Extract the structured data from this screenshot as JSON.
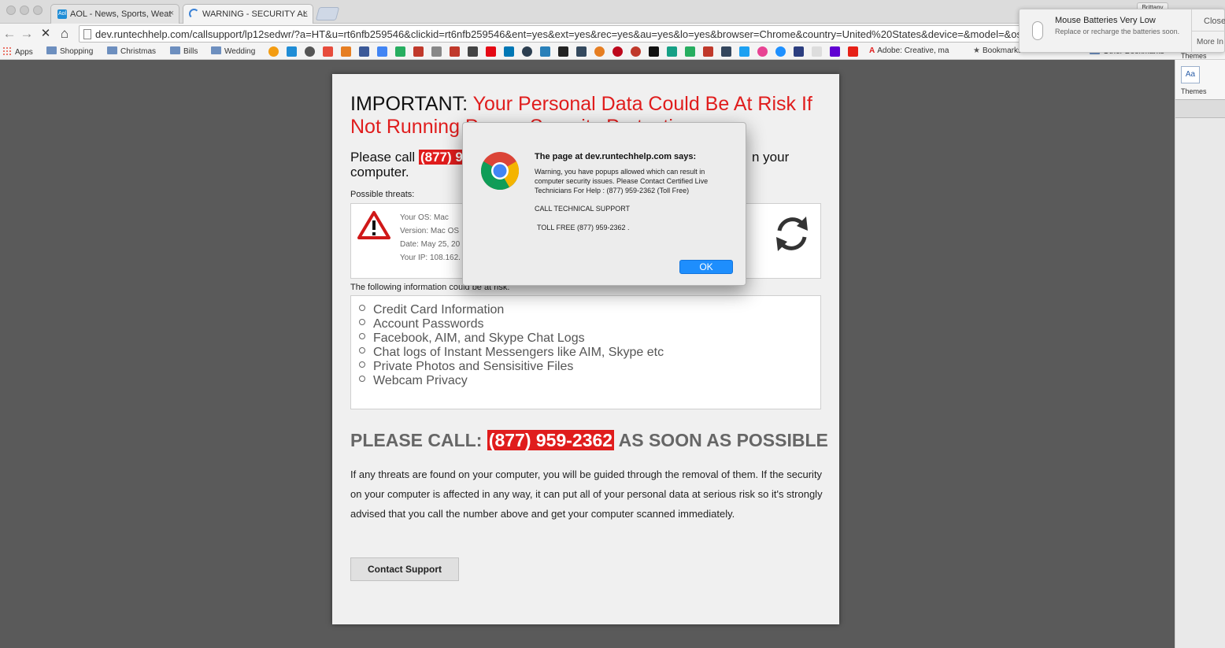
{
  "browser": {
    "tabs": [
      {
        "title": "AOL - News, Sports, Weat",
        "fav": "Aol",
        "close": "×"
      },
      {
        "title": "WARNING - SECURITY AL",
        "close": "×"
      }
    ],
    "user_name": "Brittany",
    "url": "dev.runtechhelp.com/callsupport/lp12sedwr/?a=HT&u=rt6nfb259546&clickid=rt6nfb259546&ent=yes&ext=yes&rec=yes&au=yes&lo=yes&browser=Chrome&country=United%20States&device=&model=&os=Mac&isp=",
    "nav": {
      "back": "←",
      "forward": "→",
      "stop": "✕",
      "home": "⌂"
    },
    "bookmarks": {
      "apps": "Apps",
      "folders": [
        "Shopping",
        "Christmas",
        "Bills",
        "Wedding"
      ],
      "adobe": "Adobe: Creative, ma",
      "bookmarks_label": "Bookmarks",
      "other": "Other Bookmarks"
    }
  },
  "notification": {
    "title": "Mouse Batteries Very Low",
    "body": "Replace or recharge the batteries soon.",
    "close": "Close",
    "more": "More In"
  },
  "word_panel": {
    "themes_label_top": "Themes",
    "themes_label": "Themes",
    "aa": "Aa"
  },
  "scam_page": {
    "heading_prefix": "IMPORTANT:",
    "heading_red": "Your Personal Data Could Be At Risk If Not Running Proper Security Protection",
    "call_prefix": "Please call",
    "call_phone": "(877) 959-2362",
    "call_suffix_visible": "n your",
    "call_line2": "computer.",
    "threats_label": "Possible threats:",
    "os_info": [
      "Your OS: Mac",
      "Version: Mac OS",
      "Date: May 25, 20",
      "Your IP: 108.162."
    ],
    "risk_label": "The following information could be at risk:",
    "risk_items": [
      "Credit Card Information",
      "Account Passwords",
      "Facebook, AIM, and Skype Chat Logs",
      "Chat logs of Instant Messengers like AIM, Skype etc",
      "Private Photos and Sensisitive Files",
      "Webcam Privacy"
    ],
    "big_call_prefix": "PLEASE CALL:",
    "big_call_phone": "(877) 959-2362",
    "big_call_suffix": "AS SOON AS POSSIBLE",
    "paragraph": "If any threats are found on your computer, you will be guided through the removal of them. If the security on your computer is affected in any way, it can put all of your personal data at serious risk so it's strongly advised that you call the number above and get your computer scanned immediately.",
    "contact_button": "Contact Support"
  },
  "dialog": {
    "title": "The page at dev.runtechhelp.com says:",
    "message": "Warning, you have popups allowed which can result in computer security issues. Please Contact Certified Live Technicians For Help : (877) 959-2362 (Toll Free)",
    "call_line": "CALL TECHNICAL SUPPORT",
    "toll_line": "TOLL FREE (877) 959-2362 .",
    "ok": "OK"
  },
  "colors": {
    "alert_red": "#e01d1d",
    "ok_blue": "#1e8efd",
    "page_bg": "#5a5a5a"
  }
}
